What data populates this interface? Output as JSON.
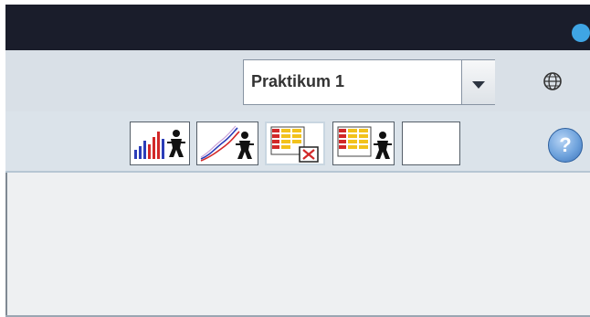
{
  "header": {
    "status_color": "#3fa5e4"
  },
  "course_selector": {
    "selected": "Praktikum 1"
  },
  "toolbar": {
    "buttons": [
      {
        "name": "bar-chart-student-tool",
        "icon": "bar-chart-person-icon"
      },
      {
        "name": "line-chart-student-tool",
        "icon": "line-chart-person-icon"
      },
      {
        "name": "delete-table-tool",
        "icon": "table-delete-icon"
      },
      {
        "name": "table-student-tool",
        "icon": "table-person-icon"
      },
      {
        "name": "empty-tool",
        "icon": "blank-icon"
      }
    ],
    "help_label": "?"
  },
  "colors": {
    "topbar": "#1a1d2b",
    "selector_bar": "#d9e0e7",
    "toolbar": "#dbe3ea",
    "content": "#eef0f2",
    "help": "#3b72b9"
  }
}
